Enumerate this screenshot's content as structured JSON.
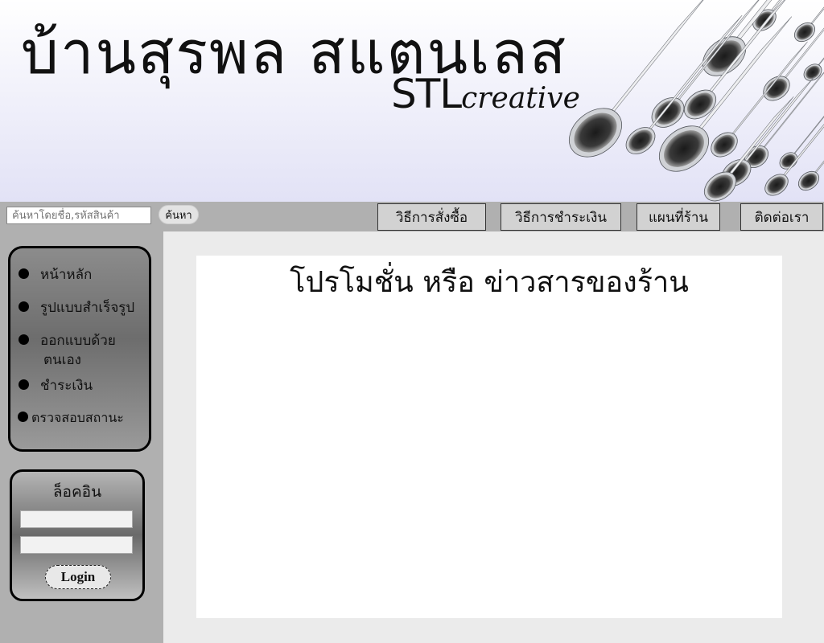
{
  "header": {
    "title_thai": "บ้านสุรพล สแตนเลส",
    "brand_prefix": "STL",
    "brand_suffix": "creative",
    "image": "stainless-pipes-image"
  },
  "toolbar": {
    "search_placeholder": "ค้นหาโดยชื่อ,รหัสสินค้า",
    "search_button": "ค้นหา",
    "nav": [
      {
        "label": "วิธีการสั่งซื้อ"
      },
      {
        "label": "วิธีการชำระเงิน"
      },
      {
        "label": "แผนที่ร้าน"
      },
      {
        "label": "ติดต่อเรา"
      }
    ]
  },
  "sidebar": {
    "menu": [
      {
        "label": "หน้าหลัก"
      },
      {
        "label": "รูปแบบสำเร็จรูป"
      },
      {
        "label": "ออกแบบด้วย"
      },
      {
        "label": "ชำระเงิน"
      },
      {
        "label": "ตรวจสอบสถานะ"
      }
    ],
    "menu_item_3_line2": "ตนเอง",
    "login": {
      "title": "ล็อคอิน",
      "button": "Login"
    }
  },
  "main": {
    "heading": "โปรโมชั่น หรือ ข่าวสารของร้าน"
  },
  "colors": {
    "page_bg": "#ebebeb",
    "bar_gray": "#b0b0b0",
    "panel_border": "#000000",
    "content_bg": "#ffffff"
  }
}
